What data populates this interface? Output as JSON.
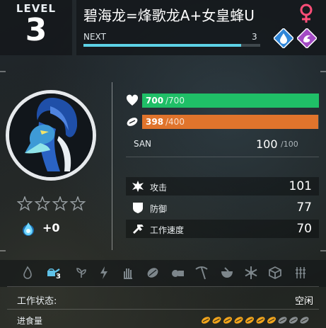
{
  "header": {
    "level_label": "LEVEL",
    "level_value": "3",
    "pal_name": "碧海龙=烽歌龙A+女皇蜂U",
    "gender_icon": "female-icon",
    "gender_color": "#ff4d78",
    "next_label": "NEXT",
    "next_value": "3",
    "exp_progress": 0.89,
    "exp_color": "#5dd2e6",
    "elements": [
      {
        "name": "water-element-icon",
        "color": "#2f86d8"
      },
      {
        "name": "dragon-element-icon",
        "color": "#a34ac4"
      }
    ]
  },
  "portrait": {
    "subject": "blue-dragon-pal"
  },
  "rank": {
    "stars_filled": 0,
    "stars_total": 4,
    "soul_icon": "soul-flame-icon",
    "soul_bonus": "+0"
  },
  "bars": {
    "hp": {
      "icon": "heart-icon",
      "current": "700",
      "max": "/700",
      "ratio": 1.0,
      "color": "#1fbf67"
    },
    "food": {
      "icon": "food-icon",
      "current": "398",
      "max": "/400",
      "ratio": 0.995,
      "color": "#e0742c"
    }
  },
  "san": {
    "label": "SAN",
    "current": "100",
    "max": "/100"
  },
  "stats": [
    {
      "icon": "attack-icon",
      "label": "攻击",
      "value": "101"
    },
    {
      "icon": "defense-icon",
      "label": "防御",
      "value": "77"
    },
    {
      "icon": "work-speed-icon",
      "label": "工作速度",
      "value": "70"
    }
  ],
  "work_suitability": {
    "icons": [
      "kindling-icon",
      "watering-icon",
      "planting-icon",
      "electricity-icon",
      "handiwork-icon",
      "gathering-icon",
      "lumbering-icon",
      "mining-icon",
      "medicine-icon",
      "cooling-icon",
      "transporting-icon",
      "farming-icon"
    ],
    "active_index": 1,
    "active_level": "3"
  },
  "work_status": {
    "label": "工作状态:",
    "value": "空闲"
  },
  "appetite": {
    "label": "进食量",
    "filled": 7,
    "total": 10,
    "filled_color": "#f2a51c",
    "empty_color": "#8a8f92"
  }
}
